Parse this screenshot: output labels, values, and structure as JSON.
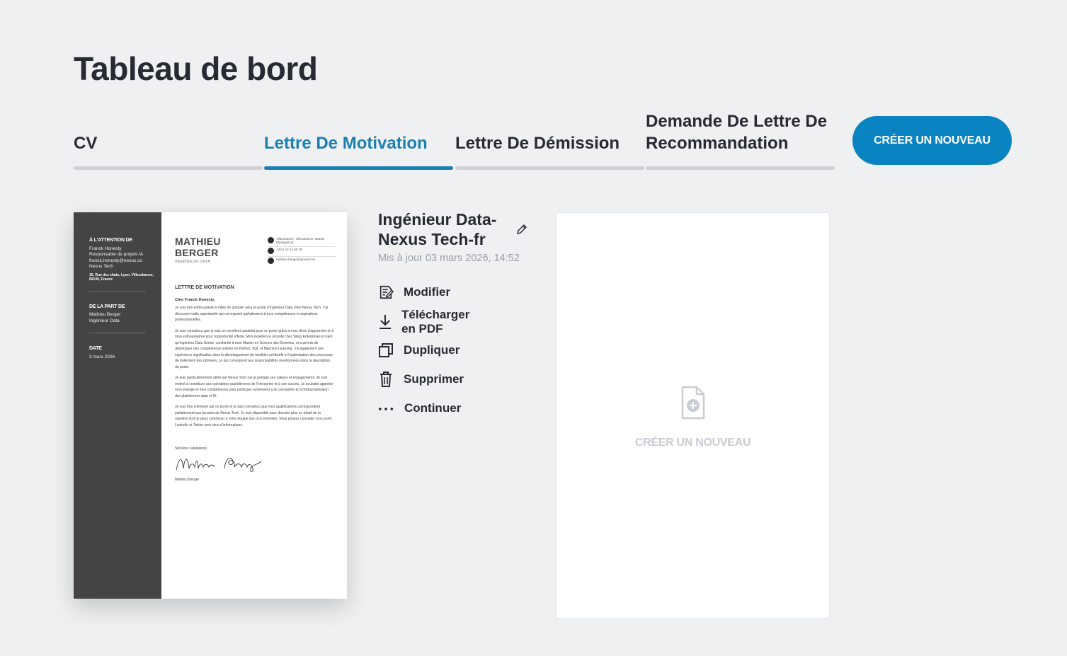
{
  "header": {
    "title": "Tableau de bord"
  },
  "tabs": [
    {
      "label": "CV",
      "active": false
    },
    {
      "label": "Lettre De Motivation",
      "active": true
    },
    {
      "label": "Lettre De Démission",
      "active": false
    },
    {
      "label": "Demande De Lettre De Recommandation",
      "active": false
    }
  ],
  "create_button": {
    "label": "CRÉER UN NOUVEAU"
  },
  "document": {
    "title": "Ingénieur Data-Nexus Tech-fr",
    "updated": "Mis à jour 03 mars 2026, 14:52",
    "actions": [
      {
        "label": "Modifier",
        "icon": "edit-document-icon"
      },
      {
        "label": "Télécharger en PDF",
        "icon": "download-icon"
      },
      {
        "label": "Dupliquer",
        "icon": "duplicate-icon"
      },
      {
        "label": "Supprimer",
        "icon": "trash-icon"
      },
      {
        "label": "Continuer",
        "icon": "more-dots-icon"
      }
    ]
  },
  "preview": {
    "side": {
      "to_heading": "À L'ATTENTION DE",
      "to_name": "Franck Honesty",
      "to_role": "Responsable de projets IA",
      "to_email": "franck.honesty@nexus.co",
      "to_company": "Nexus Tech",
      "to_address": "15, Rue des chats, Lyon, Villeurbanne, 69100, France",
      "from_heading": "DE LA PART DE",
      "from_name": "Mathieu Berger",
      "from_role": "Ingénieur Data",
      "date_heading": "DATE",
      "date_value": "3 mars 2026"
    },
    "name_first": "MATHIEU",
    "name_last": "BERGER",
    "role": "INGÉNIEUR DATA",
    "contact": {
      "address": "Villeurbanne, Villeurbanne, 69100, Madagascar",
      "phone": "+33 6 12 34 56 78",
      "email": "mathieu.berger@gmail.com"
    },
    "subject": "LETTRE DE MOTIVATION",
    "greeting": "Cher Franck Honesty,",
    "paragraphs": [
      "Je suis très enthousiaste à l'idée de postuler pour le poste d'Ingénieur Data chez Nexus Tech. J'ai découvert cette opportunité qui correspond parfaitement à mes compétences et aspirations professionnelles.",
      "Je suis convaincu que je suis un excellent candidat pour ce poste grâce à mon désir d'apprendre et à mon enthousiasme pour l'opportunité offerte. Mon expérience récente chez Warp Enterprises en tant qu'Ingénieur Data Senior, combinée à mon Master en Science des Données, m'a permis de développer des compétences solides en Python, SQL et Machine Learning. J'ai également une expérience significative dans le développement de modèles prédictifs et l'optimisation des processus de traitement des données, ce qui correspond aux responsabilités mentionnées dans la description du poste.",
      "Je suis particulièrement attiré par Nexus Tech car je partage ses valeurs et engagements. Je suis motivé à contribuer aux opérations quotidiennes de l'entreprise et à son succès. Je souhaite apporter mon énergie et mes compétences pour participer activement à la conception et à l'industrialisation des plateformes data et IA.",
      "Je suis très intéressé par ce poste et je suis convaincu que mes qualifications correspondent parfaitement aux besoins de Nexus Tech. Je suis disponible pour discuter plus en détail de la manière dont je peux contribuer à votre équipe lors d'un entretien. Vous pouvez consulter mon profil LinkedIn et Twitter pour plus d'informations."
    ],
    "closing": "Sincères salutations,",
    "signer": "Mathieu Berger"
  },
  "new_card": {
    "label": "CRÉER UN NOUVEAU",
    "icon": "add-file-icon"
  },
  "colors": {
    "accent": "#1b7fb4",
    "button": "#0a83c2",
    "background": "#eff0f2",
    "sidebar": "#444446"
  }
}
